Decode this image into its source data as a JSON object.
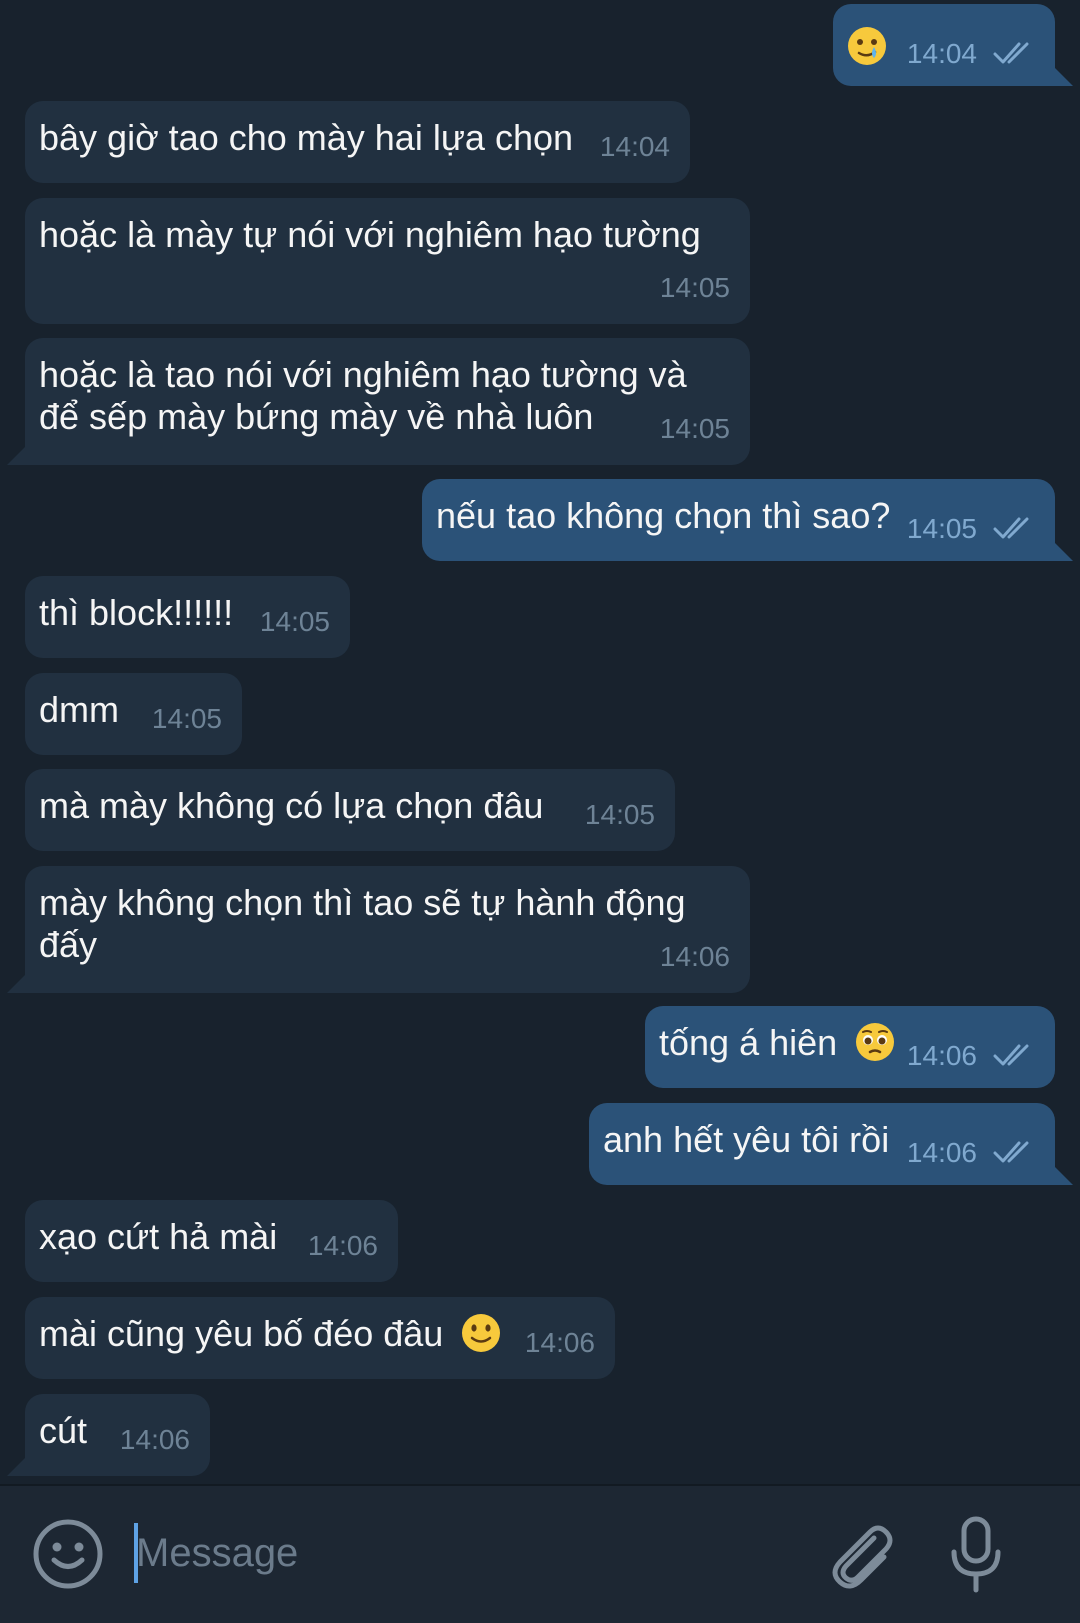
{
  "messages": [
    {
      "dir": "out",
      "text": "",
      "emoji": "tear-smile-emoji",
      "time": "14:04",
      "status": "double-check-icon"
    },
    {
      "dir": "in",
      "text": "bây giờ tao cho mày hai lựa chọn",
      "time": "14:04"
    },
    {
      "dir": "in",
      "text": "hoặc là mày tự nói với nghiêm hạo tường",
      "time": "14:05"
    },
    {
      "dir": "in",
      "text": "hoặc là tao nói với nghiêm hạo tường và để sếp mày bứng mày về nhà luôn",
      "time": "14:05"
    },
    {
      "dir": "out",
      "text": "nếu tao không chọn thì sao?",
      "time": "14:05",
      "status": "double-check-icon"
    },
    {
      "dir": "in",
      "text": "thì block!!!!!!",
      "time": "14:05"
    },
    {
      "dir": "in",
      "text": "dmm",
      "time": "14:05"
    },
    {
      "dir": "in",
      "text": "mà mày không có lựa chọn đâu",
      "time": "14:05"
    },
    {
      "dir": "in",
      "text": "mày không chọn thì tao sẽ tự hành động đấy",
      "time": "14:06"
    },
    {
      "dir": "out",
      "text": "tống á hiên",
      "emoji": "pleading-face-emoji",
      "time": "14:06",
      "status": "double-check-icon"
    },
    {
      "dir": "out",
      "text": "anh hết yêu tôi rồi",
      "time": "14:06",
      "status": "double-check-icon"
    },
    {
      "dir": "in",
      "text": "xạo cứt hả mài",
      "time": "14:06"
    },
    {
      "dir": "in",
      "text": "mài cũng yêu bố đéo đâu",
      "emoji": "slight-smile-emoji",
      "time": "14:06"
    },
    {
      "dir": "in",
      "text": "cút",
      "time": "14:06"
    }
  ],
  "composer": {
    "placeholder": "Message",
    "emoji_button_icon": "smile-icon",
    "attach_icon": "paperclip-icon",
    "mic_icon": "microphone-icon"
  },
  "colors": {
    "background": "#18222d",
    "incoming_bubble": "#213040",
    "outgoing_bubble": "#2b5278",
    "composer": "#1d2733",
    "cursor": "#5ea2e5"
  }
}
